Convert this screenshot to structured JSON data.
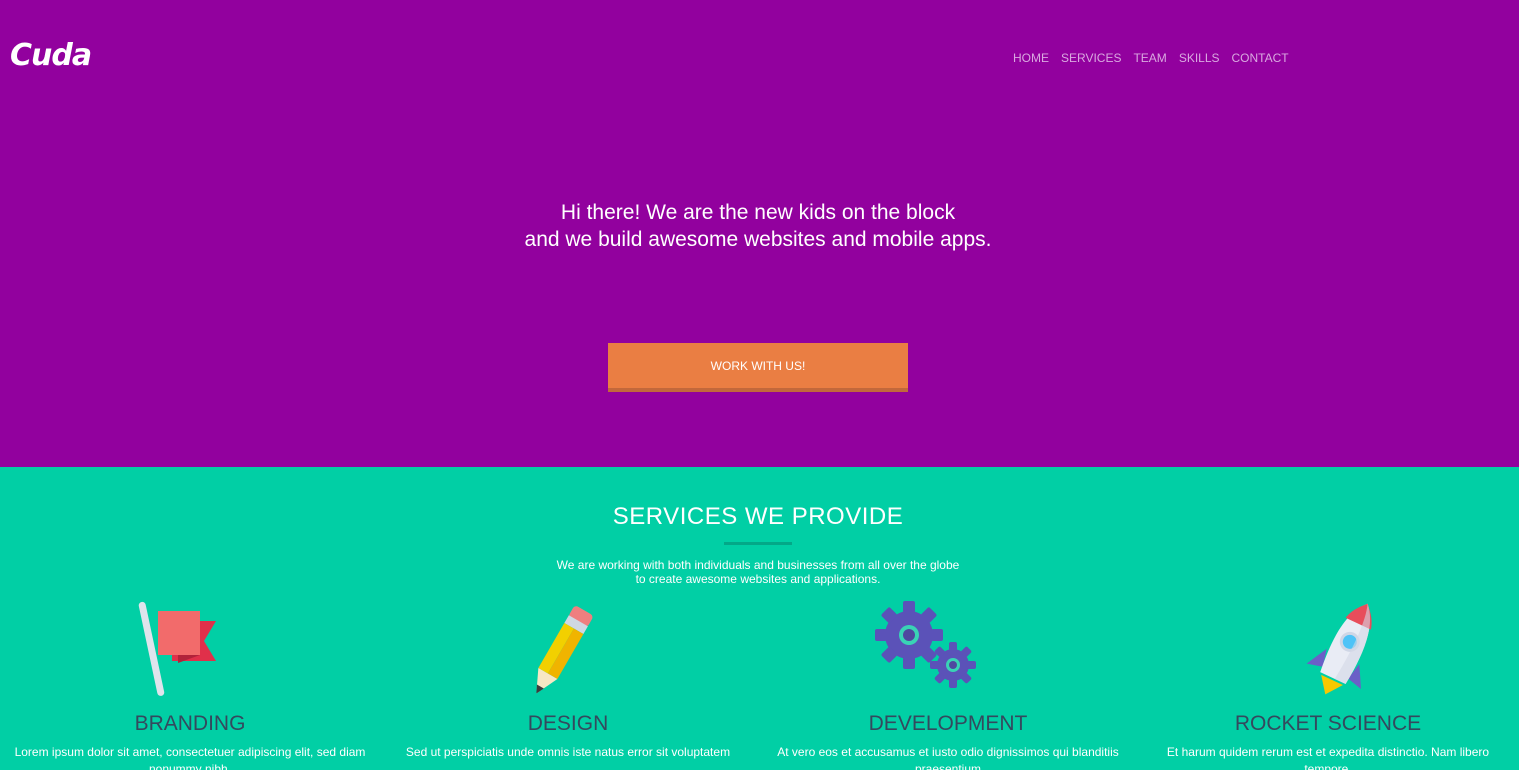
{
  "brand": {
    "logo_text": "Cuda"
  },
  "nav": {
    "items": [
      "HOME",
      "SERVICES",
      "TEAM",
      "SKILLS",
      "CONTACT"
    ]
  },
  "hero": {
    "line1": "Hi there! We are the new kids on the block",
    "line2": "and we build awesome websites and mobile apps.",
    "cta_label": "WORK WITH US!"
  },
  "services": {
    "title": "SERVICES WE PROVIDE",
    "subtitle_line1": "We are working with both individuals and businesses from all over the globe",
    "subtitle_line2": "to create awesome websites and applications.",
    "cards": [
      {
        "icon": "flag-icon",
        "title": "BRANDING",
        "text": "Lorem ipsum dolor sit amet, consectetuer adipiscing elit, sed diam nonummy nibh."
      },
      {
        "icon": "pencil-icon",
        "title": "DESIGN",
        "text": "Sed ut perspiciatis unde omnis iste natus error sit voluptatem"
      },
      {
        "icon": "gears-icon",
        "title": "DEVELOPMENT",
        "text": "At vero eos et accusamus et iusto odio dignissimos qui blanditiis praesentium"
      },
      {
        "icon": "rocket-icon",
        "title": "ROCKET SCIENCE",
        "text": "Et harum quidem rerum est et expedita distinctio. Nam libero tempore."
      }
    ]
  },
  "colors": {
    "hero_bg": "#92019e",
    "services_bg": "#01cfa5",
    "cta_bg": "#ea7e43"
  }
}
